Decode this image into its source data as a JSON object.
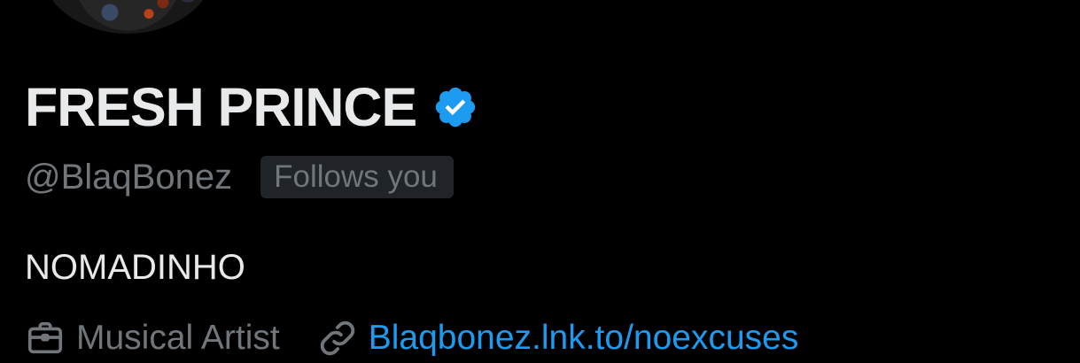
{
  "profile": {
    "display_name": "FRESH PRINCE",
    "handle": "@BlaqBonez",
    "follows_you_badge": "Follows you",
    "bio": "NOMADINHO",
    "verified_badge_icon": "verified-check-icon",
    "verified_color": "#1d9bf0"
  },
  "meta": {
    "category_icon": "briefcase-icon",
    "category": "Musical Artist",
    "link_icon": "link-icon",
    "link_text": "Blaqbonez.lnk.to/noexcuses",
    "link_color": "#1d9bf0"
  },
  "colors": {
    "background": "#000000",
    "primary_text": "#e7e9ea",
    "secondary_text": "#71767b",
    "badge_background": "#202327"
  }
}
